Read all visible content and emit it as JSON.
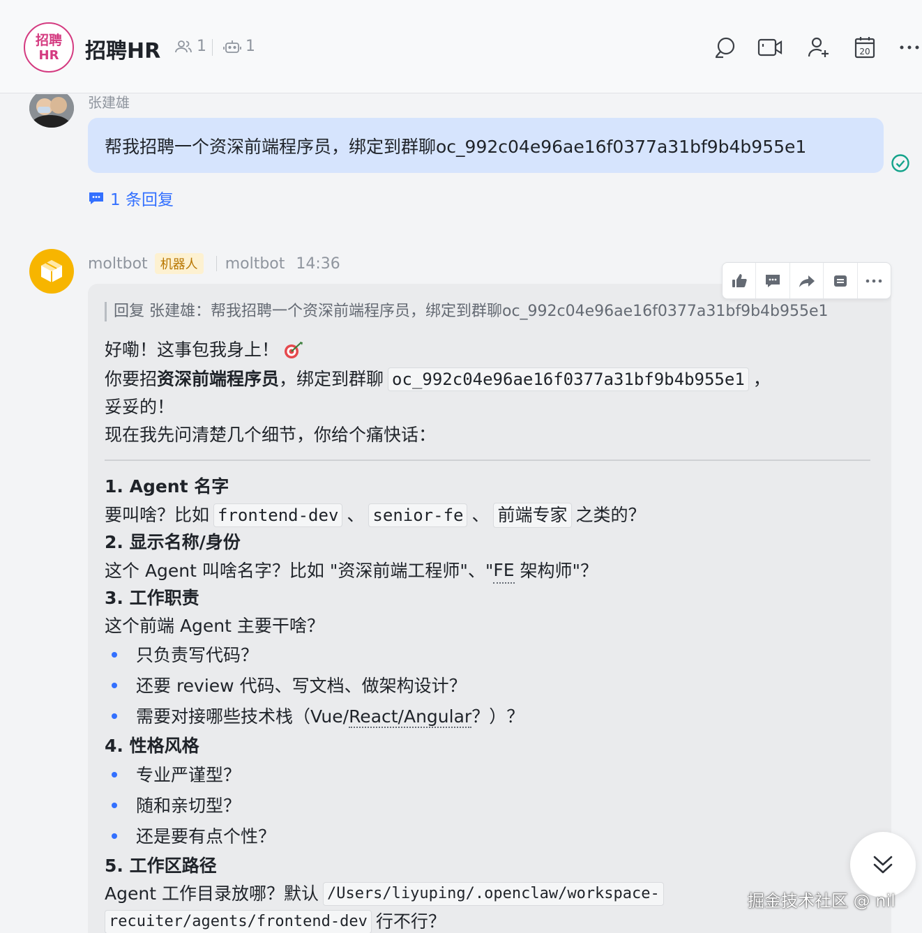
{
  "header": {
    "group_avatar_line1": "招聘",
    "group_avatar_line2": "HR",
    "title": "招聘HR",
    "member_count": "1",
    "bot_count": "1",
    "actions": [
      "search-icon",
      "video-call-icon",
      "add-member-icon",
      "calendar-icon",
      "more-icon"
    ],
    "calendar_day": "20"
  },
  "user_message": {
    "sender": "张建雄",
    "text": "帮我招聘一个资深前端程序员，绑定到群聊oc_992c04e96ae16f0377a31bf9b4b955e1",
    "reply_count_label": "1 条回复"
  },
  "bot_message": {
    "name": "moltbot",
    "badge": "机器人",
    "via": "moltbot",
    "time": "14:36",
    "quote": "回复 张建雄：帮我招聘一个资深前端程序员，绑定到群聊oc_992c04e96ae16f0377a31bf9b4b955e1",
    "intro_1": "好嘞！这事包我身上！",
    "intro_2a": "你要招",
    "intro_2b": "资深前端程序员",
    "intro_2c": "，绑定到群聊",
    "intro_2_code": "oc_992c04e96ae16f0377a31bf9b4b955e1",
    "intro_2d": "，",
    "intro_3": "妥妥的！",
    "intro_4": "现在我先问清楚几个细节，你给个痛快话：",
    "s1_title": "1. Agent 名字",
    "s1_a": "要叫啥？比如",
    "s1_code1": "frontend-dev",
    "s1_sep1": "、",
    "s1_code2": "senior-fe",
    "s1_sep2": "、",
    "s1_code3": "前端专家",
    "s1_b": "之类的？",
    "s2_title": "2. 显示名称/身份",
    "s2_a": "这个 Agent 叫啥名字？比如 \"资深前端工程师\"、\"",
    "s2_fe": "FE",
    "s2_b": " 架构师\"？",
    "s3_title": "3. 工作职责",
    "s3_a": "这个前端 Agent 主要干啥？",
    "s3_b1": "只负责写代码？",
    "s3_b2": "还要 review 代码、写文档、做架构设计？",
    "s3_b3a": "需要对接哪些技术栈（Vue/",
    "s3_b3b": "React/Angular",
    "s3_b3c": "？）？",
    "s4_title": "4. 性格风格",
    "s4_b1": "专业严谨型？",
    "s4_b2": "随和亲切型？",
    "s4_b3": "还是要有点个性？",
    "s5_title": "5. 工作区路径",
    "s5_a": "Agent 工作目录放哪？默认",
    "s5_code1": "/Users/liyuping/.openclaw/workspace-",
    "s5_code2": "recuiter/agents/frontend-dev",
    "s5_b": "行不行？"
  },
  "toolbar": [
    "thumbs-up-icon",
    "comment-icon",
    "forward-icon",
    "pin-icon",
    "more-icon"
  ],
  "watermark": "掘金技术社区 @ nil",
  "colors": {
    "accent": "#3370ff",
    "user_bubble": "#d6e4fd",
    "bot_bubble": "#eaebed",
    "group_avatar": "#d43a80",
    "bot_avatar": "#f7b500",
    "check": "#14a38b"
  }
}
